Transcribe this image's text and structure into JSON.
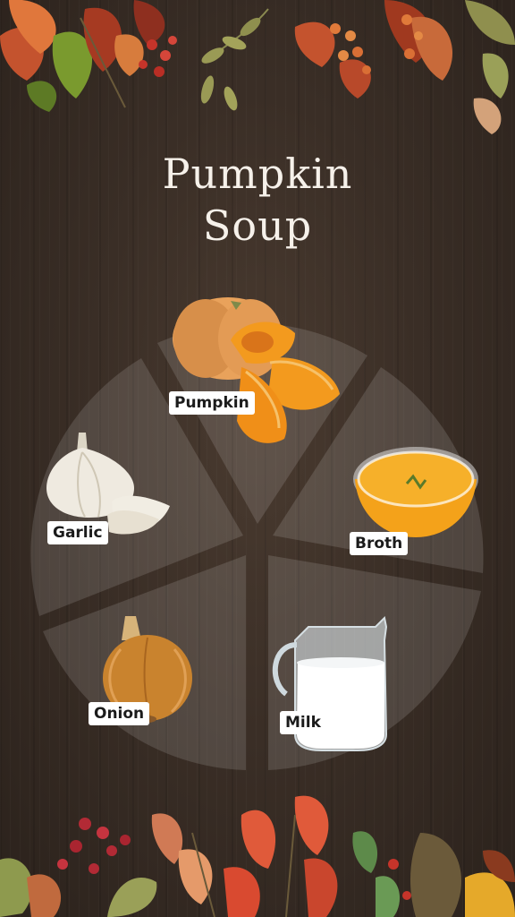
{
  "title": {
    "line1": "Pumpkin",
    "line2": "Soup"
  },
  "ingredients": [
    {
      "id": "pumpkin",
      "label": "Pumpkin"
    },
    {
      "id": "broth",
      "label": "Broth"
    },
    {
      "id": "milk",
      "label": "Milk"
    },
    {
      "id": "onion",
      "label": "Onion"
    },
    {
      "id": "garlic",
      "label": "Garlic"
    }
  ],
  "colors": {
    "background": "#3a2e26",
    "wheel_fill": "rgba(255,255,255,0.13)",
    "label_bg": "#ffffff",
    "title_text": "#f6f1ea",
    "pumpkin": "#f39a1e",
    "broth": "#f4a21a"
  },
  "icons": [
    "pumpkin-image",
    "broth-bowl-image",
    "milk-jug-image",
    "onion-image",
    "garlic-image",
    "autumn-leaves-top",
    "autumn-leaves-bottom"
  ]
}
